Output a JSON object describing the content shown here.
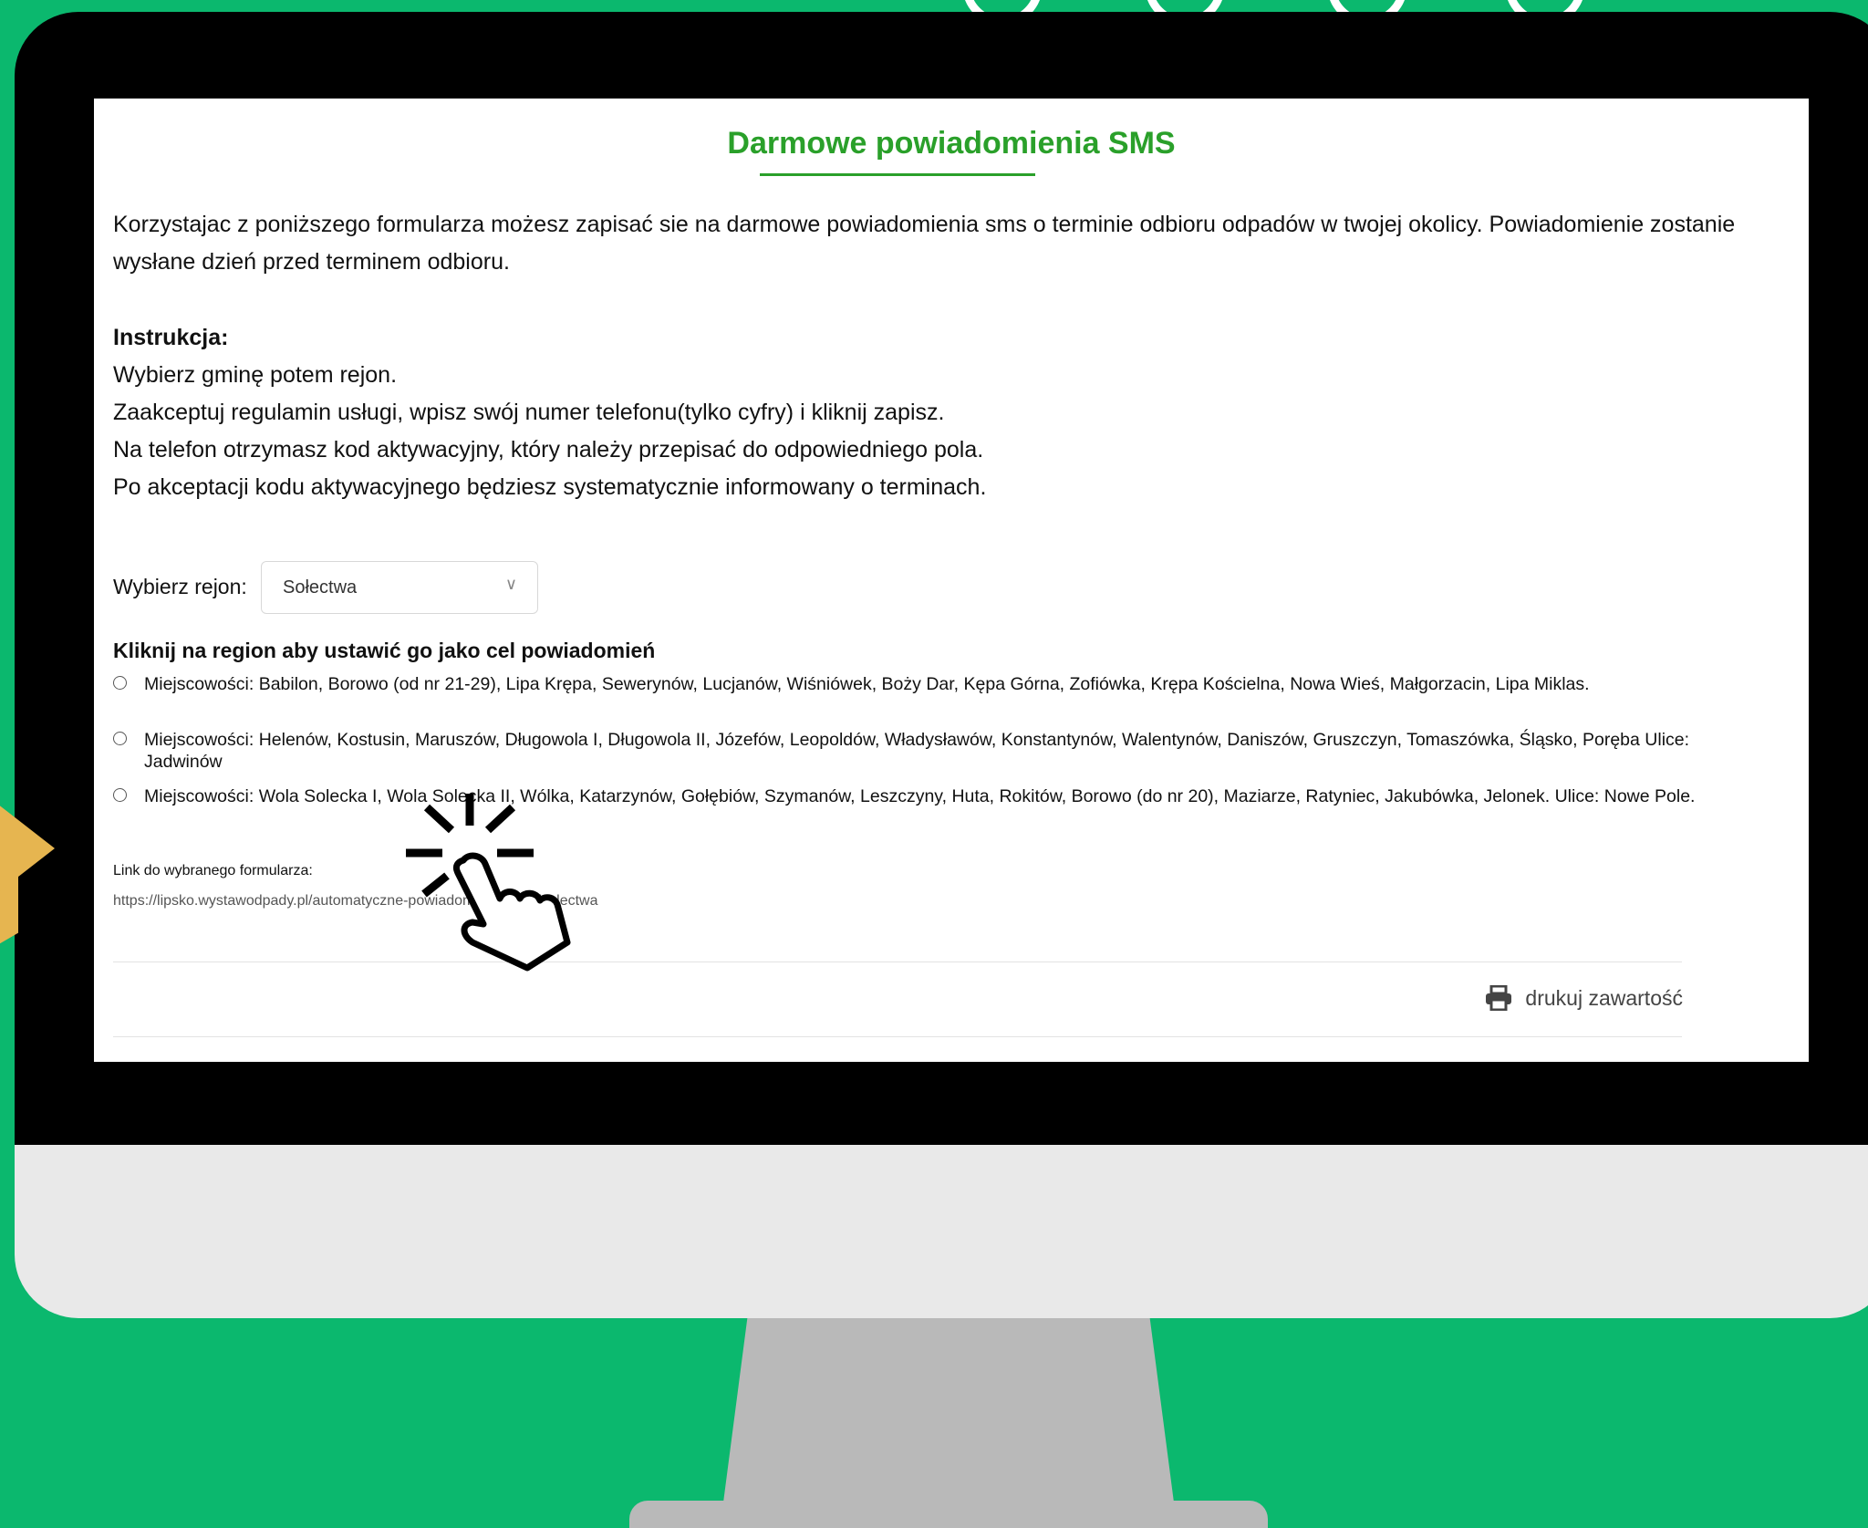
{
  "page": {
    "title": "Darmowe powiadomienia SMS",
    "intro": "Korzystajac z poniższego formularza możesz zapisać sie na darmowe powiadomienia sms o terminie odbioru odpadów w twojej okolicy. Powiadomienie zostanie wysłane dzień przed terminem odbioru.",
    "instructions_heading": "Instrukcja:",
    "instructions": [
      "Wybierz gminę potem rejon.",
      "Zaakceptuj regulamin usługi, wpisz swój numer telefonu(tylko cyfry) i kliknij zapisz.",
      "Na telefon otrzymasz kod aktywacyjny, który należy przepisać do odpowiedniego pola.",
      "Po akceptacji kodu aktywacyjnego będziesz systematycznie informowany o terminach."
    ]
  },
  "form": {
    "rejon_label": "Wybierz rejon:",
    "rejon_value": "Sołectwa",
    "regions_heading": "Kliknij na region aby ustawić go jako cel powiadomień",
    "regions": [
      "Miejscowości: Babilon, Borowo (od nr 21-29), Lipa Krępa, Sewerynów, Lucjanów, Wiśniówek, Boży Dar, Kępa Górna, Zofiówka, Krępa Kościelna, Nowa Wieś, Małgorzacin, Lipa Miklas.",
      "Miejscowości: Helenów, Kostusin, Maruszów, Długowola I, Długowola II, Józefów, Leopoldów, Władysławów, Konstantynów, Walentynów, Daniszów, Gruszczyn, Tomaszówka, Śląsko, Poręba Ulice: Jadwinów",
      "Miejscowości: Wola Solecka I, Wola Solecka II, Wólka, Katarzynów, Gołębiów, Szymanów, Leszczyny, Huta, Rokitów, Borowo (do nr 20), Maziarze, Ratyniec, Jakubówka, Jelonek. Ulice: Nowe Pole."
    ],
    "link_label": "Link do wybranego formularza:",
    "link_url": "https://lipsko.wystawodpady.pl/automatyczne-powiadomienia-sms/solectwa"
  },
  "footer": {
    "print_label": "drukuj zawartość"
  },
  "icons": {
    "select": "chevron-down-icon",
    "print": "printer-icon",
    "cursor": "pointer-hand-icon"
  },
  "colors": {
    "background": "#0bb86e",
    "accent": "#2aa02a",
    "arrow": "#e6b550"
  }
}
